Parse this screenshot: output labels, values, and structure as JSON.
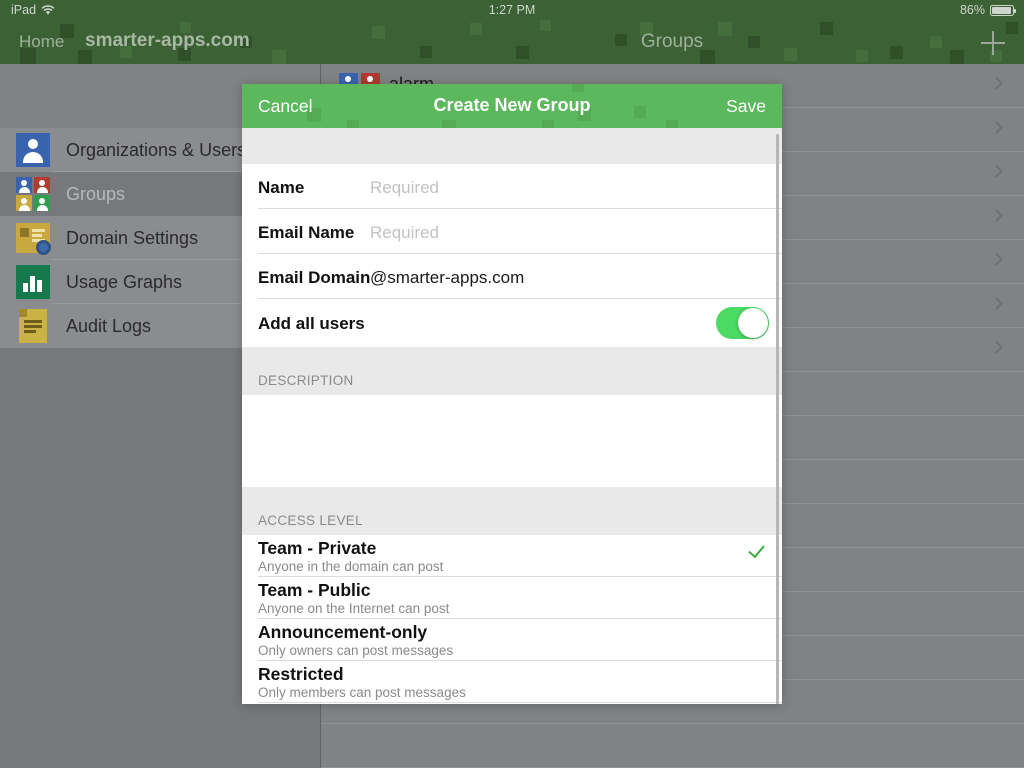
{
  "status_bar": {
    "device": "iPad",
    "wifi_icon": "wifi-icon",
    "time": "1:27 PM",
    "battery_percent": "86%",
    "battery_icon": "battery-icon"
  },
  "nav_bar": {
    "back_label": "Home",
    "domain_title": "smarter-apps.com",
    "detail_title": "Groups",
    "add_icon": "plus-icon",
    "background_color": "#3b6134"
  },
  "sidebar": {
    "items": [
      {
        "label": "Organizations & Users",
        "icon": "person-icon",
        "selected": false
      },
      {
        "label": "Groups",
        "icon": "group-grid-icon",
        "selected": true
      },
      {
        "label": "Domain Settings",
        "icon": "settings-card-icon",
        "selected": false
      },
      {
        "label": "Usage Graphs",
        "icon": "bar-chart-icon",
        "selected": false
      },
      {
        "label": "Audit Logs",
        "icon": "document-icon",
        "selected": false
      }
    ]
  },
  "detail_list": {
    "rows": [
      {
        "name": "alarm",
        "chevron": "chevron-right-icon"
      },
      {
        "name": "",
        "chevron": "chevron-right-icon"
      },
      {
        "name": "",
        "chevron": "chevron-right-icon"
      },
      {
        "name": "",
        "chevron": "chevron-right-icon"
      },
      {
        "name": "",
        "chevron": "chevron-right-icon"
      },
      {
        "name": "",
        "chevron": "chevron-right-icon"
      },
      {
        "name": "",
        "chevron": "chevron-right-icon"
      },
      {
        "name": "",
        "chevron": ""
      },
      {
        "name": "",
        "chevron": ""
      }
    ]
  },
  "modal": {
    "cancel_label": "Cancel",
    "title": "Create New Group",
    "save_label": "Save",
    "header_color": "#5cb85c",
    "fields": [
      {
        "label": "Name",
        "value": "",
        "placeholder": "Required"
      },
      {
        "label": "Email Name",
        "value": "",
        "placeholder": "Required"
      },
      {
        "label": "Email Domain",
        "value": "@smarter-apps.com",
        "placeholder": ""
      }
    ],
    "toggle_row": {
      "label": "Add all users",
      "state": "on",
      "on_color": "#4cd964"
    },
    "description": {
      "header": "DESCRIPTION",
      "value": "",
      "placeholder": ""
    },
    "access_level": {
      "header": "ACCESS LEVEL",
      "check_icon": "checkmark-icon",
      "check_color": "#3aab3a",
      "options": [
        {
          "title": "Team - Private",
          "subtitle": "Anyone in the domain can post",
          "selected": true
        },
        {
          "title": "Team - Public",
          "subtitle": "Anyone on the Internet can post",
          "selected": false
        },
        {
          "title": "Announcement-only",
          "subtitle": "Only owners can post messages",
          "selected": false
        },
        {
          "title": "Restricted",
          "subtitle": "Only members can post messages",
          "selected": false
        }
      ]
    },
    "scrollbar": "vertical-scrollbar"
  }
}
